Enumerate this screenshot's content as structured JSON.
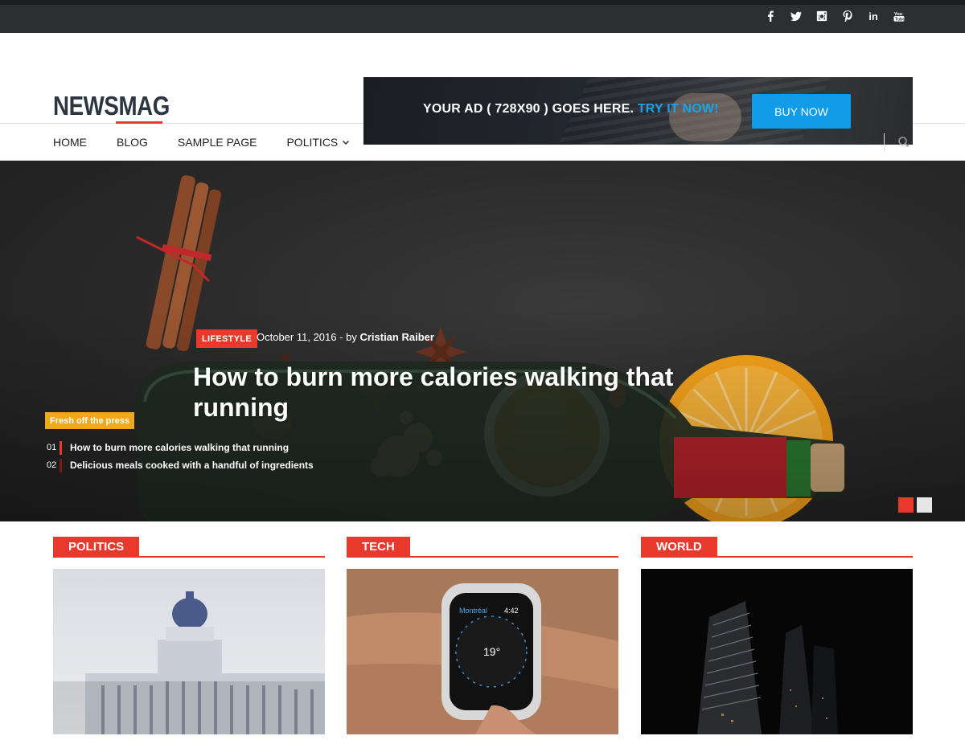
{
  "social": {
    "icons": [
      "facebook-icon",
      "twitter-icon",
      "instagram-icon",
      "pinterest-icon",
      "linkedin-icon",
      "youtube-icon"
    ],
    "linkedin_text": "in",
    "youtube_text": "You"
  },
  "header": {
    "logo": "NEWSMAG",
    "ad": {
      "text": "YOUR AD ( 728X90 ) GOES HERE.",
      "highlight": "TRY IT NOW!",
      "button": "BUY NOW"
    }
  },
  "nav": {
    "items": [
      "HOME",
      "BLOG",
      "SAMPLE PAGE",
      "POLITICS"
    ],
    "dropdown_icon": "chevron-down-icon",
    "search_icon": "search-icon"
  },
  "hero": {
    "category": "LIFESTYLE",
    "date": "October 11, 2016",
    "separator": "-",
    "by": "by",
    "author": "Cristian Raiber",
    "title": "How to burn more calories walking that running",
    "fresh_label": "Fresh off the press",
    "fresh_items": [
      {
        "num": "01",
        "text": "How to burn more calories walking that running"
      },
      {
        "num": "02",
        "text": "Delicious meals cooked with a handful of ingredients"
      }
    ],
    "slides": 2,
    "active_slide": 1
  },
  "categories": [
    {
      "label": "POLITICS"
    },
    {
      "label": "TECH"
    },
    {
      "label": "WORLD"
    }
  ],
  "watch": {
    "city": "Montréal",
    "time": "4:42",
    "temp": "19°"
  },
  "colors": {
    "accent": "#e8392c",
    "ad_link": "#1aa3e8",
    "ad_button": "#109ce8",
    "fresh_badge": "#f0a81c",
    "topbar": "#2b2f32",
    "logo": "#2b3640"
  }
}
